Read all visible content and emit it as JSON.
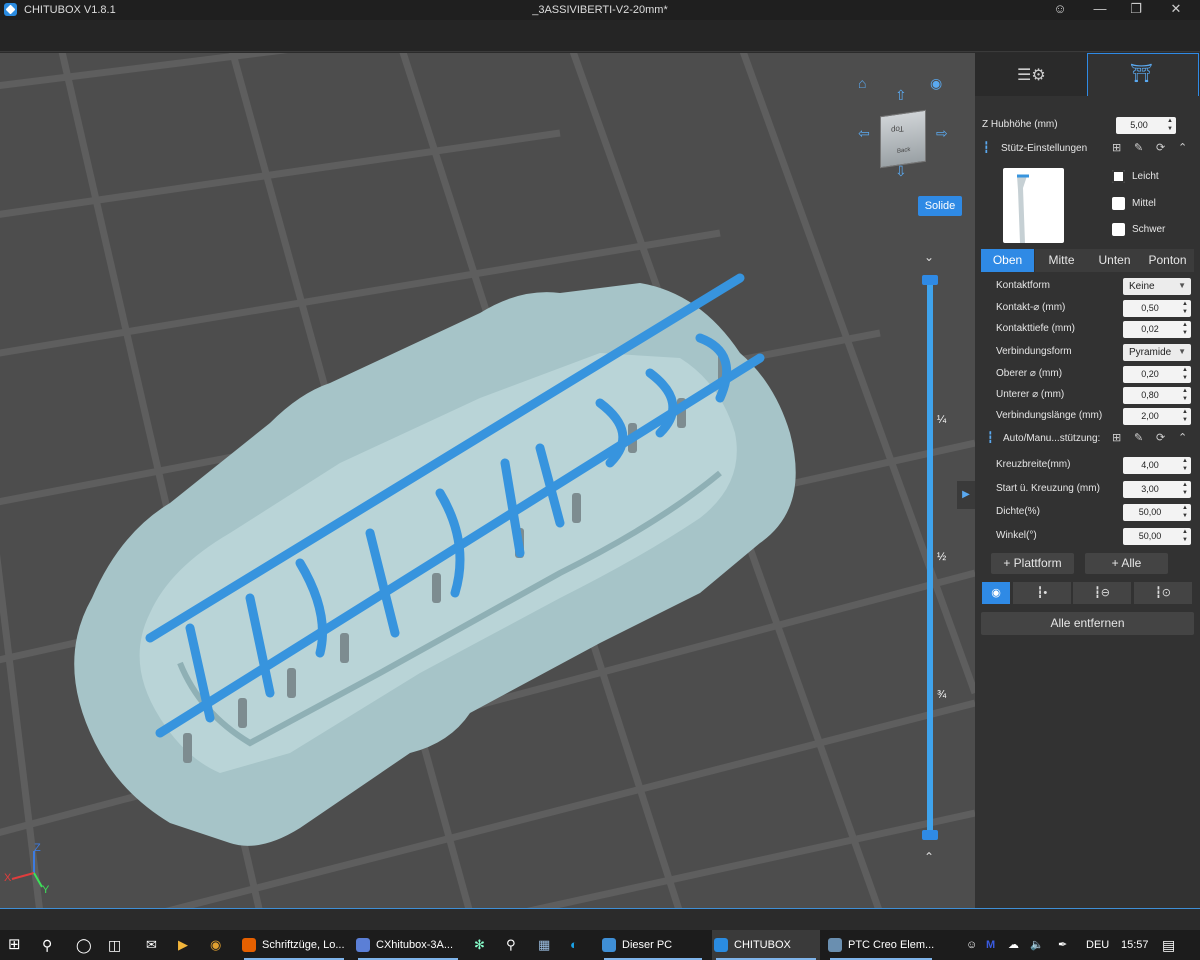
{
  "window": {
    "app_title": "CHITUBOX V1.8.1",
    "document_title": "_3ASSIVIBERTI-V2-20mm*",
    "user_icon": "user-icon",
    "minimize": "—",
    "maximize": "❐",
    "close": "✕"
  },
  "viewport": {
    "view_cube": {
      "top": "Top",
      "back": "Back"
    },
    "render_mode": "Solide",
    "slider_ticks": [
      "¾",
      "½",
      "¼"
    ],
    "model_text": "3ASSIVIBERTI",
    "axes": {
      "x": "X",
      "y": "Y",
      "z": "Z"
    },
    "colors": {
      "floor": "#4d4d4d",
      "grid": "#5d5d5d",
      "base": "#a6c4c8",
      "text": "#3794de"
    }
  },
  "sidebar": {
    "z_lift": {
      "label": "Z Hubhöhe (mm)",
      "value": "5,00"
    },
    "support_settings": {
      "title": "Stütz-Einstellungen",
      "presets": [
        {
          "label": "Leicht",
          "checked": true
        },
        {
          "label": "Mittel",
          "checked": false
        },
        {
          "label": "Schwer",
          "checked": false
        }
      ]
    },
    "segments": [
      "Oben",
      "Mitte",
      "Unten",
      "Ponton"
    ],
    "fields": [
      {
        "label": "Kontaktform",
        "value": "Keine",
        "type": "dropdown"
      },
      {
        "label": "Kontakt-⌀ (mm)",
        "value": "0,50",
        "type": "spin"
      },
      {
        "label": "Kontakttiefe (mm)",
        "value": "0,02",
        "type": "spin"
      },
      {
        "label": "Verbindungsform",
        "value": "Pyramide",
        "type": "dropdown"
      },
      {
        "label": "Oberer ⌀ (mm)",
        "value": "0,20",
        "type": "spin"
      },
      {
        "label": "Unterer ⌀ (mm)",
        "value": "0,80",
        "type": "spin"
      },
      {
        "label": "Verbindungslänge (mm)",
        "value": "2,00",
        "type": "spin"
      }
    ],
    "auto_section": {
      "title": "Auto/Manu...stützung:"
    },
    "auto_fields": [
      {
        "label": "Kreuzbreite(mm)",
        "value": "4,00"
      },
      {
        "label": "Start ü. Kreuzung (mm)",
        "value": "3,00"
      },
      {
        "label": "Dichte(%)",
        "value": "50,00"
      },
      {
        "label": "Winkel(°)",
        "value": "50,00"
      }
    ],
    "buttons": {
      "plattform": "+ Plattform",
      "alle": "+ Alle",
      "remove_all": "Alle entfernen"
    }
  },
  "taskbar": {
    "apps": [
      {
        "label": "Schriftzüge, Lo...",
        "color": "#e66000"
      },
      {
        "label": "CXhitubox-3A...",
        "color": "#5b7fd6"
      },
      {
        "label": "Dieser PC",
        "color": "#3f8fd6"
      },
      {
        "label": "CHITUBOX",
        "color": "#2a8be0",
        "active": true
      },
      {
        "label": "PTC Creo Elem...",
        "color": "#6a8fb0"
      }
    ],
    "language": "DEU",
    "time": "15:57"
  }
}
